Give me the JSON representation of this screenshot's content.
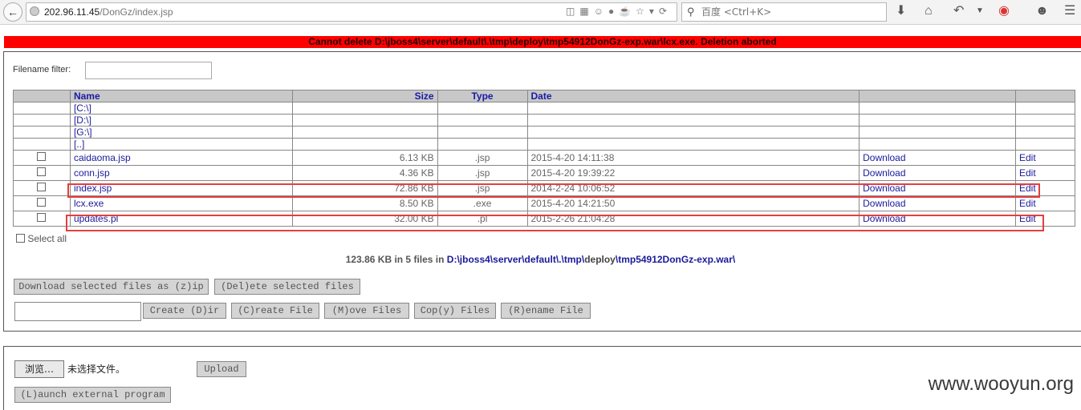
{
  "browser": {
    "url_host": "202.96.11.45",
    "url_path": "/DonGz/index.jsp",
    "search_placeholder": "百度 <Ctrl+K>"
  },
  "error_message": "Cannot delete D:\\jboss4\\server\\default\\.\\tmp\\deploy\\tmp54912DonGz-exp.war\\lcx.exe. Deletion aborted",
  "filter": {
    "label": "Filename filter:",
    "value": ""
  },
  "table": {
    "headers": {
      "name": "Name",
      "size": "Size",
      "type": "Type",
      "date": "Date"
    },
    "drives": [
      "[C:\\]",
      "[D:\\]",
      "[G:\\]",
      "[..]"
    ],
    "files": [
      {
        "name": "caidaoma.jsp",
        "size": "6.13 KB",
        "type": ".jsp",
        "date": "2015-4-20 14:11:38",
        "download": "Download",
        "edit": "Edit"
      },
      {
        "name": "conn.jsp",
        "size": "4.36 KB",
        "type": ".jsp",
        "date": "2015-4-20 19:39:22",
        "download": "Download",
        "edit": "Edit"
      },
      {
        "name": "index.jsp",
        "size": "72.86 KB",
        "type": ".jsp",
        "date": "2014-2-24 10:06:52",
        "download": "Download",
        "edit": "Edit"
      },
      {
        "name": "lcx.exe",
        "size": "8.50 KB",
        "type": ".exe",
        "date": "2015-4-20 14:21:50",
        "download": "Download",
        "edit": "Edit"
      },
      {
        "name": "updates.pl",
        "size": "32.00 KB",
        "type": ".pl",
        "date": "2015-2-26 21:04:28",
        "download": "Download",
        "edit": "Edit"
      }
    ]
  },
  "select_all_label": "Select all",
  "summary": {
    "text": "123.86 KB in 5 files in",
    "path_1": "D:\\jboss4\\server\\default\\.\\tmp\\",
    "path_2": "deploy",
    "path_3": "\\tmp54912DonGz-exp.war\\"
  },
  "buttons": {
    "download_zip": "Download selected files as (z)ip",
    "delete": "(Del)ete selected files",
    "create_dir": "Create (D)ir",
    "create_file": "(C)reate File",
    "move_files": "(M)ove Files",
    "copy_files": "Cop(y) Files",
    "rename_file": "(R)ename File",
    "browse": "浏览…",
    "upload": "Upload",
    "launch": "(L)aunch external program"
  },
  "no_file_text": "未选择文件。",
  "watermark": "www.wooyun.org",
  "colors": {
    "error_bg": "#ff0000",
    "highlight": "#e53e3e",
    "link": "#1a1a9c"
  }
}
